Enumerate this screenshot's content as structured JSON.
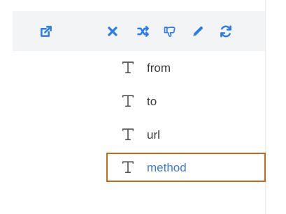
{
  "toolbar": {
    "icons": [
      "open-external-icon",
      "close-icon",
      "shuffle-icon",
      "dislike-icon",
      "pencil-icon",
      "refresh-icon"
    ],
    "accent_color": "#2b7de9"
  },
  "fields": [
    {
      "label": "from",
      "icon": "text-type-icon",
      "selected": false
    },
    {
      "label": "to",
      "icon": "text-type-icon",
      "selected": false
    },
    {
      "label": "url",
      "icon": "text-type-icon",
      "selected": false
    },
    {
      "label": "method",
      "icon": "text-type-icon",
      "selected": true
    }
  ],
  "colors": {
    "selected_border": "#c26b1b",
    "selected_text": "#3b7ad9",
    "field_text": "#3a3a3a",
    "toolbar_background": "#f3f4f6"
  }
}
